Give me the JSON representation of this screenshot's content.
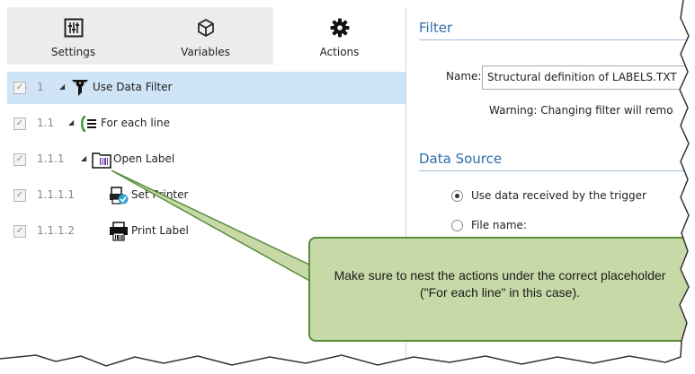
{
  "tabs": [
    {
      "label": "Settings",
      "icon": "settings-sliders-icon"
    },
    {
      "label": "Variables",
      "icon": "cube-icon"
    },
    {
      "label": "Actions",
      "icon": "gear-icon"
    }
  ],
  "tree": [
    {
      "checked": "✓",
      "number": "1",
      "label": "Use Data Filter",
      "icon": "funnel-icon",
      "selected": true
    },
    {
      "checked": "✓",
      "number": "1.1",
      "label": "For each line",
      "icon": "loop-lines-icon"
    },
    {
      "checked": "✓",
      "number": "1.1.1",
      "label": "Open Label",
      "icon": "folder-label-icon"
    },
    {
      "checked": "✓",
      "number": "1.1.1.1",
      "label": "Set Printer",
      "icon": "set-printer-icon"
    },
    {
      "checked": "✓",
      "number": "1.1.1.2",
      "label": "Print Label",
      "icon": "printer-icon"
    }
  ],
  "filter": {
    "heading": "Filter",
    "name_label": "Name:",
    "name_value": "Structural definition of LABELS.TXT",
    "warning": "Warning: Changing filter will remo"
  },
  "data_source": {
    "heading": "Data Source",
    "option_trigger": "Use data received by the trigger",
    "option_file": "File name:"
  },
  "callout": {
    "text": "Make sure to nest the actions under the correct placeholder (\"For each line\" in this case)."
  },
  "colors": {
    "accent_blue": "#2f6ea8",
    "selection": "#cfe4f7",
    "callout_fill": "#c6d9a7",
    "callout_border": "#5a8c3a"
  }
}
